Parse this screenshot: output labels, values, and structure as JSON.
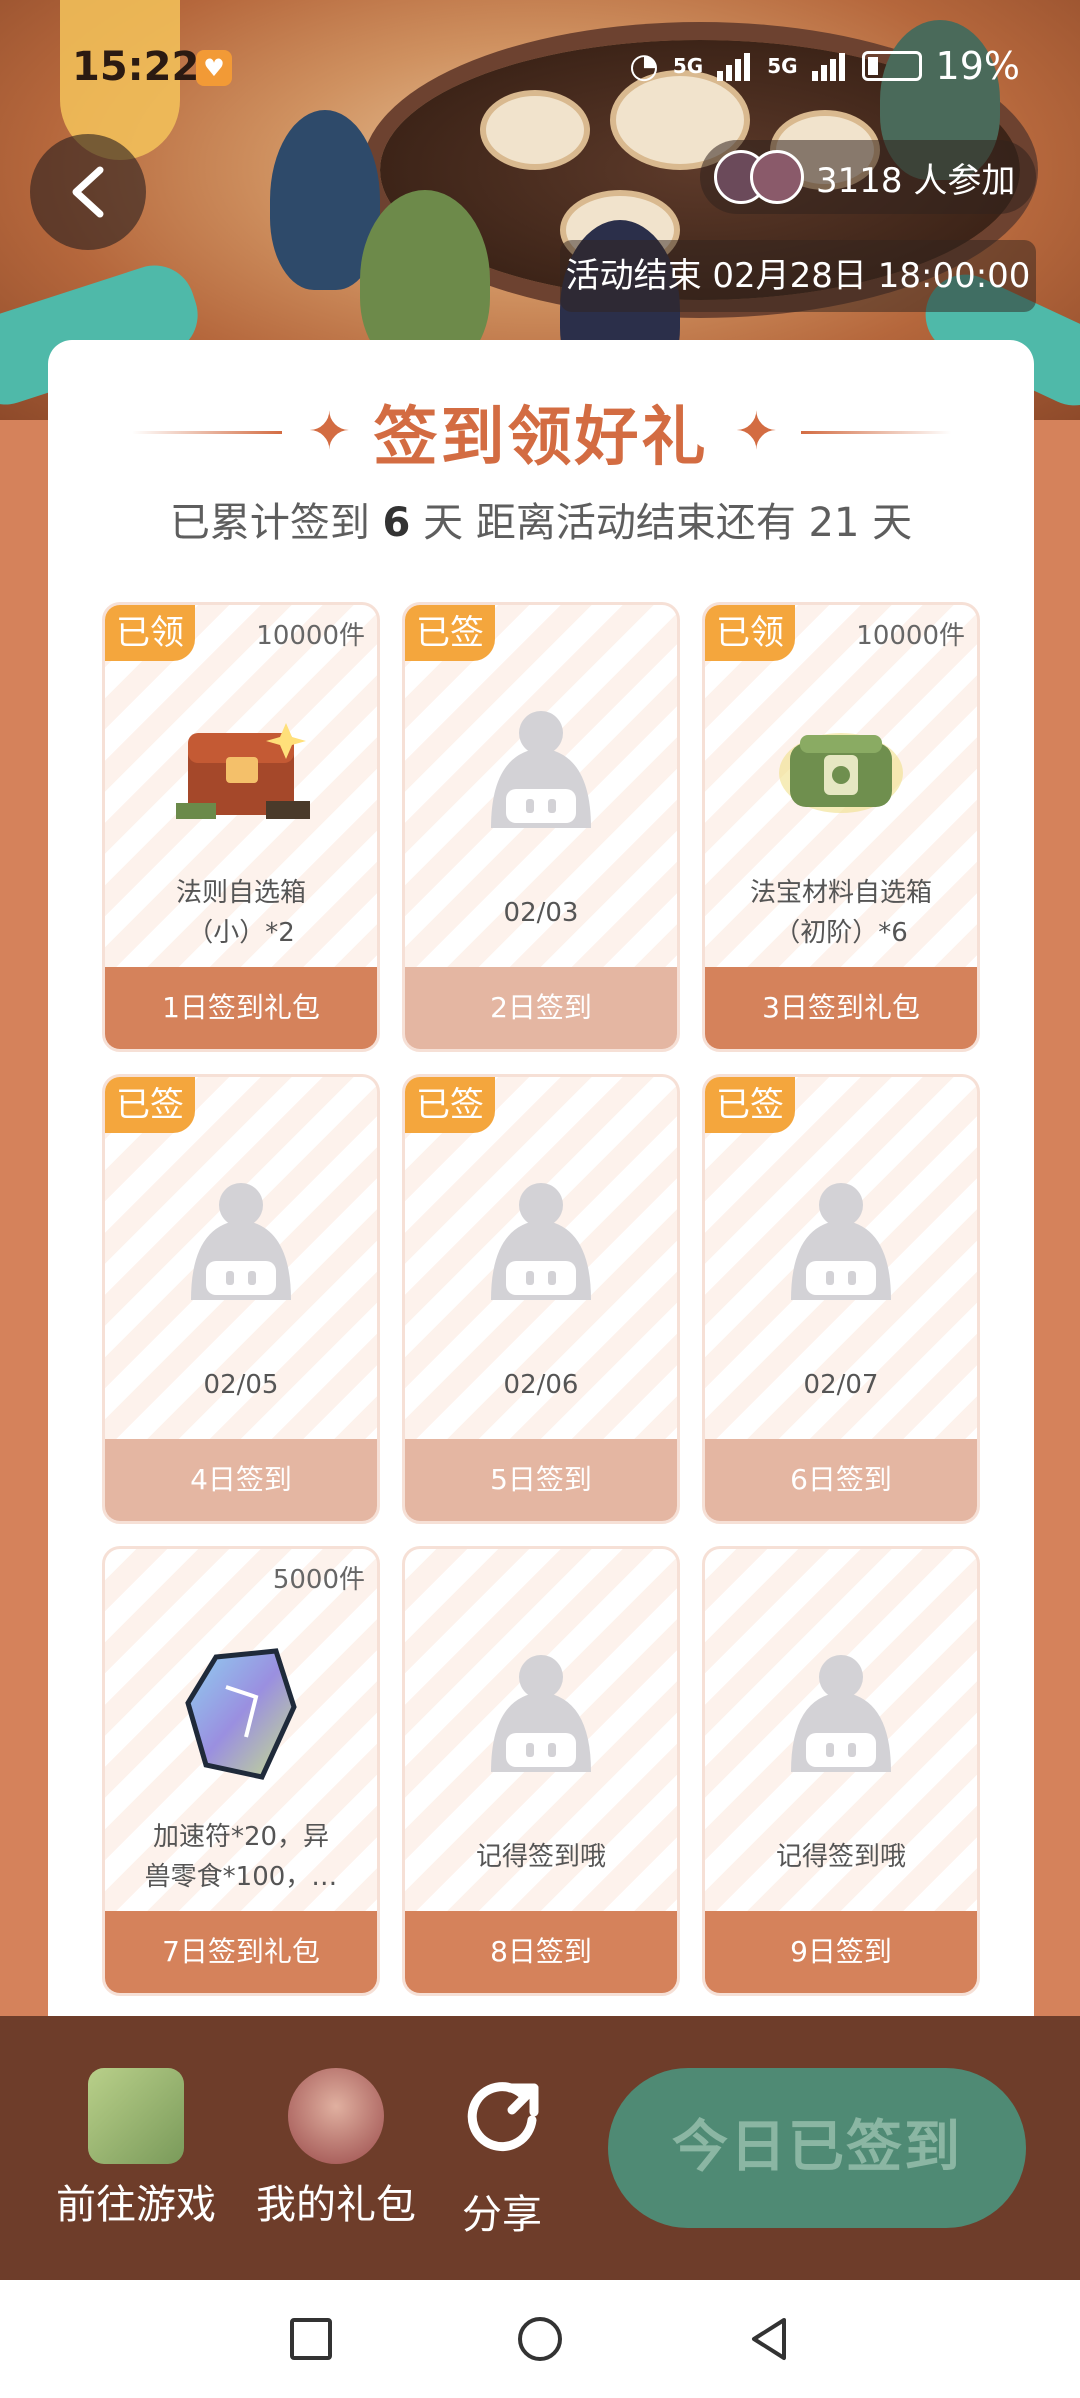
{
  "status": {
    "time": "15:22",
    "network1": "5G",
    "network2": "5G",
    "battery": "19%"
  },
  "banner": {
    "participants_text": "3118 人参加",
    "end_time": "活动结束 02月28日 18:00:00"
  },
  "card": {
    "title": "签到领好礼",
    "subtitle_prefix": "已累计签到",
    "signed_days": "6",
    "subtitle_mid": "天   距离活动结束还有 21 天"
  },
  "cells": [
    {
      "badge": "已领",
      "qty": "10000件",
      "caption1": "法则自选箱",
      "caption2": "（小）*2",
      "footer": "1日签到礼包",
      "image": "chest-icon"
    },
    {
      "badge": "已签",
      "qty": "",
      "caption1": "02/03",
      "caption2": "",
      "footer": "2日签到",
      "image": "placeholder-mascot-icon"
    },
    {
      "badge": "已领",
      "qty": "10000件",
      "caption1": "法宝材料自选箱",
      "caption2": "（初阶）*6",
      "footer": "3日签到礼包",
      "image": "jade-box-icon"
    },
    {
      "badge": "已签",
      "qty": "",
      "caption1": "02/05",
      "caption2": "",
      "footer": "4日签到",
      "image": "placeholder-mascot-icon"
    },
    {
      "badge": "已签",
      "qty": "",
      "caption1": "02/06",
      "caption2": "",
      "footer": "5日签到",
      "image": "placeholder-mascot-icon"
    },
    {
      "badge": "已签",
      "qty": "",
      "caption1": "02/07",
      "caption2": "",
      "footer": "6日签到",
      "image": "placeholder-mascot-icon"
    },
    {
      "badge": "",
      "qty": "5000件",
      "caption1": "加速符*20，异",
      "caption2": "兽零食*100，…",
      "footer": "7日签到礼包",
      "image": "crystal-icon"
    },
    {
      "badge": "",
      "qty": "",
      "caption1": "记得签到哦",
      "caption2": "",
      "footer": "8日签到",
      "image": "placeholder-mascot-icon"
    },
    {
      "badge": "",
      "qty": "",
      "caption1": "记得签到哦",
      "caption2": "",
      "footer": "9日签到",
      "image": "placeholder-mascot-icon"
    }
  ],
  "bottombar": {
    "go_game": "前往游戏",
    "my_gifts": "我的礼包",
    "share": "分享",
    "today_button": "今日已签到"
  },
  "colors": {
    "accent": "#d36c42",
    "badge": "#f4a63d",
    "bottom_bar": "#6e3d2a",
    "today_button": "#4f8a74"
  }
}
